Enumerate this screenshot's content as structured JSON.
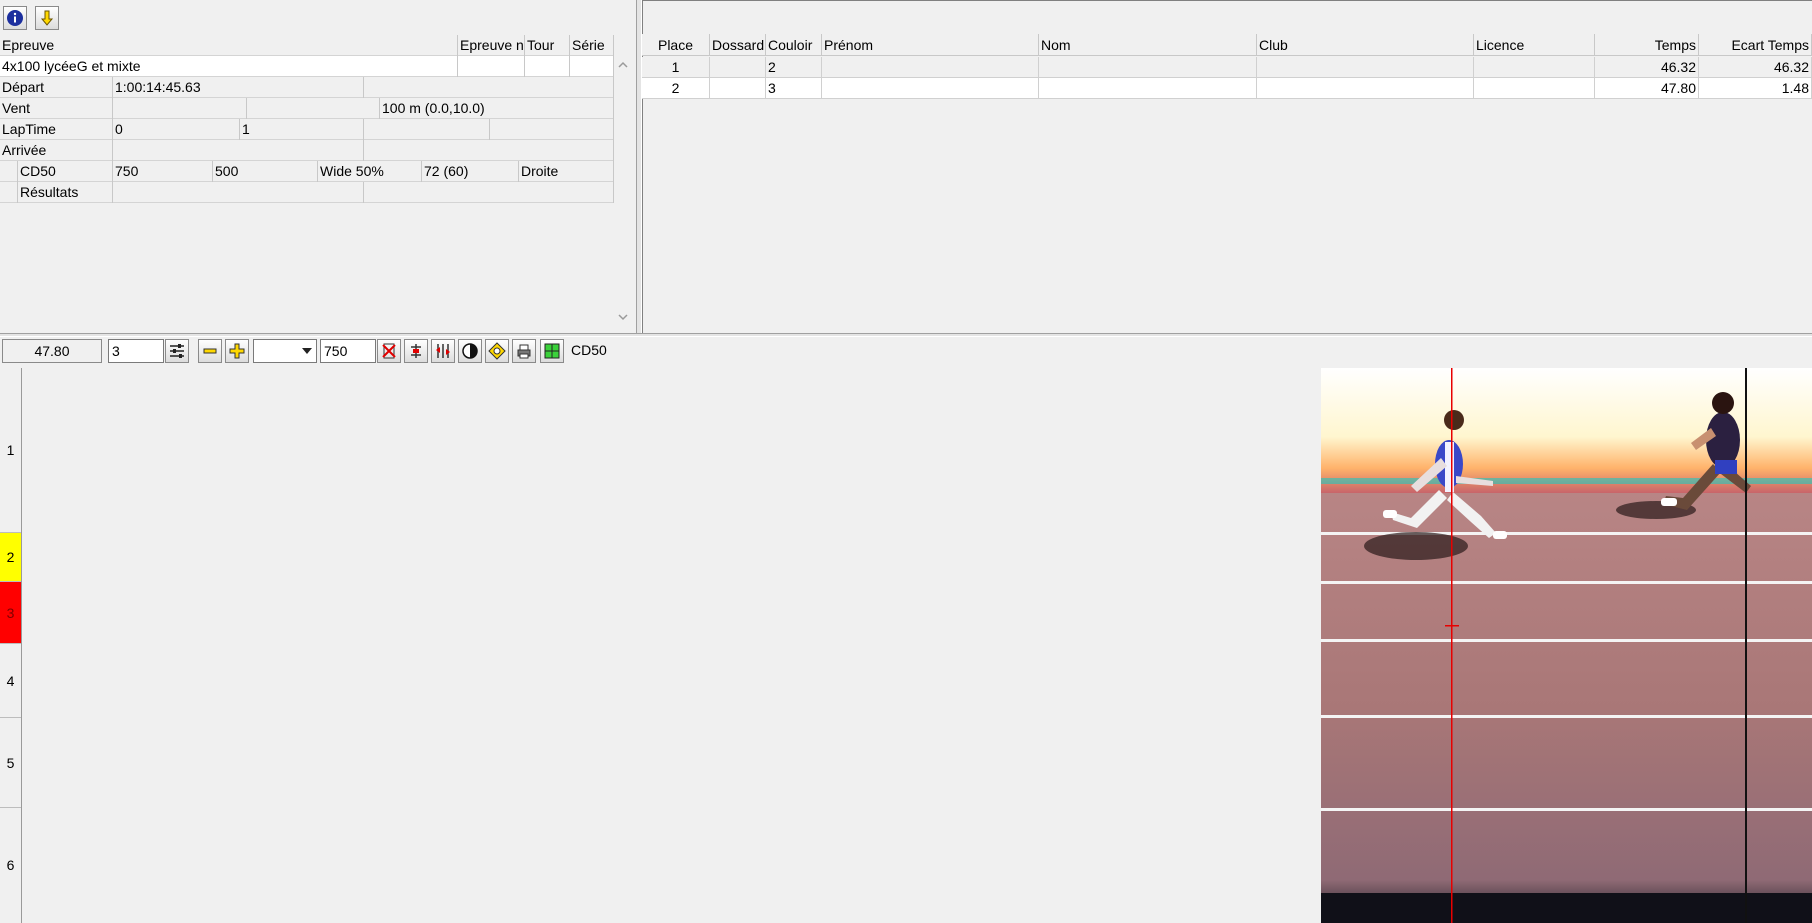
{
  "toolbar_left": {
    "icons": [
      "info-icon",
      "download-arrow-icon"
    ]
  },
  "event_grid": {
    "headers": {
      "epreuve": "Epreuve",
      "epreuve_n": "Epreuve n",
      "tour": "Tour",
      "serie": "Série"
    },
    "epreuve_name": "4x100 lycéeG et mixte",
    "depart_label": "Départ",
    "depart_value": "1:00:14:45.63",
    "vent_label": "Vent",
    "vent_value": "100 m (0.0,10.0)",
    "laptime_label": "LapTime",
    "laptime_a": "0",
    "laptime_b": "1",
    "arrivee_label": "Arrivée",
    "camera_label": "CD50",
    "camera_v1": "750",
    "camera_v2": "500",
    "camera_v3": "Wide 50%",
    "camera_v4": "72  (60)",
    "camera_v5": "Droite",
    "resultats_label": "Résultats"
  },
  "results_table": {
    "headers": [
      "Place",
      "Dossard",
      "Couloir",
      "Prénom",
      "Nom",
      "Club",
      "Licence",
      "Temps",
      "Ecart Temps"
    ],
    "rows": [
      {
        "place": "1",
        "dossard": "",
        "couloir": "2",
        "prenom": "",
        "nom": "",
        "club": "",
        "licence": "",
        "temps": "46.32",
        "ecart": "46.32"
      },
      {
        "place": "2",
        "dossard": "",
        "couloir": "3",
        "prenom": "",
        "nom": "",
        "club": "",
        "licence": "",
        "temps": "47.80",
        "ecart": "1.48"
      }
    ]
  },
  "photo_toolbar": {
    "time": "47.80",
    "lane": "3",
    "zoom_select": "",
    "speed": "750",
    "camera": "CD50"
  },
  "lanes": [
    {
      "label": "1",
      "color": "#f0f0f0"
    },
    {
      "label": "2",
      "color": "#ffff00"
    },
    {
      "label": "3",
      "color": "#ff0000"
    },
    {
      "label": "4",
      "color": "#f0f0f0"
    },
    {
      "label": "5",
      "color": "#f0f0f0"
    },
    {
      "label": "6",
      "color": "#f0f0f0"
    }
  ]
}
